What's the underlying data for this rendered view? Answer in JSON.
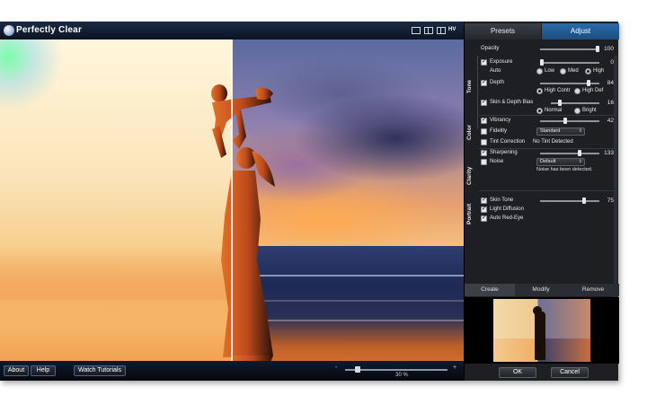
{
  "app": {
    "title": "Perfectly Clear",
    "view_mode_label": "HV"
  },
  "panel_tabs": {
    "presets": "Presets",
    "adjust": "Adjust"
  },
  "opacity": {
    "label": "Opacity",
    "value": "100",
    "level": 1.0
  },
  "sections": {
    "tone": "Tone",
    "color": "Color",
    "clarity": "Clarity",
    "portrait": "Portrait"
  },
  "tone": {
    "exposure": {
      "label": "Exposure",
      "value": "0",
      "level": 0.0,
      "checked": true
    },
    "auto": {
      "label": "Auto",
      "options": [
        "Low",
        "Med",
        "High"
      ],
      "selected": "High"
    },
    "depth": {
      "label": "Depth",
      "value": "84",
      "level": 0.84,
      "checked": true,
      "options": [
        "High Contr",
        "High Def"
      ],
      "selected": "High Contr"
    },
    "skin_depth_bias": {
      "label": "Skin & Depth Bias",
      "value": "16",
      "level": 0.16,
      "checked": true,
      "options": [
        "Normal",
        "Bright"
      ],
      "selected": "Normal"
    }
  },
  "color": {
    "vibrancy": {
      "label": "Vibrancy",
      "value": "42",
      "level": 0.42,
      "checked": true
    },
    "fidelity": {
      "label": "Fidelity",
      "selected": "Standard",
      "checked": false
    },
    "tint_correction": {
      "label": "Tint Correction",
      "note": "No Tint Detected",
      "checked": false
    }
  },
  "clarity": {
    "sharpening": {
      "label": "Sharpening",
      "value": "133",
      "level": 0.67,
      "checked": true
    },
    "noise": {
      "label": "Noise",
      "selected": "Default",
      "note": "Noise has been detected.",
      "checked": false
    }
  },
  "portrait": {
    "skin_tone": {
      "label": "Skin Tone",
      "value": "75",
      "level": 0.75,
      "checked": true
    },
    "light_diffusion": {
      "label": "Light Diffusion",
      "checked": true
    },
    "auto_red_eye": {
      "label": "Auto Red-Eye",
      "checked": true
    }
  },
  "preset_tabs": {
    "create": "Create",
    "modify": "Modify",
    "remove": "Remove"
  },
  "dialog": {
    "ok": "OK",
    "cancel": "Cancel"
  },
  "bottom": {
    "about": "About",
    "help": "Help",
    "tutorials": "Watch Tutorials",
    "zoom_minus": "-",
    "zoom_plus": "+",
    "zoom": "30 %",
    "zoom_level": 0.1
  }
}
